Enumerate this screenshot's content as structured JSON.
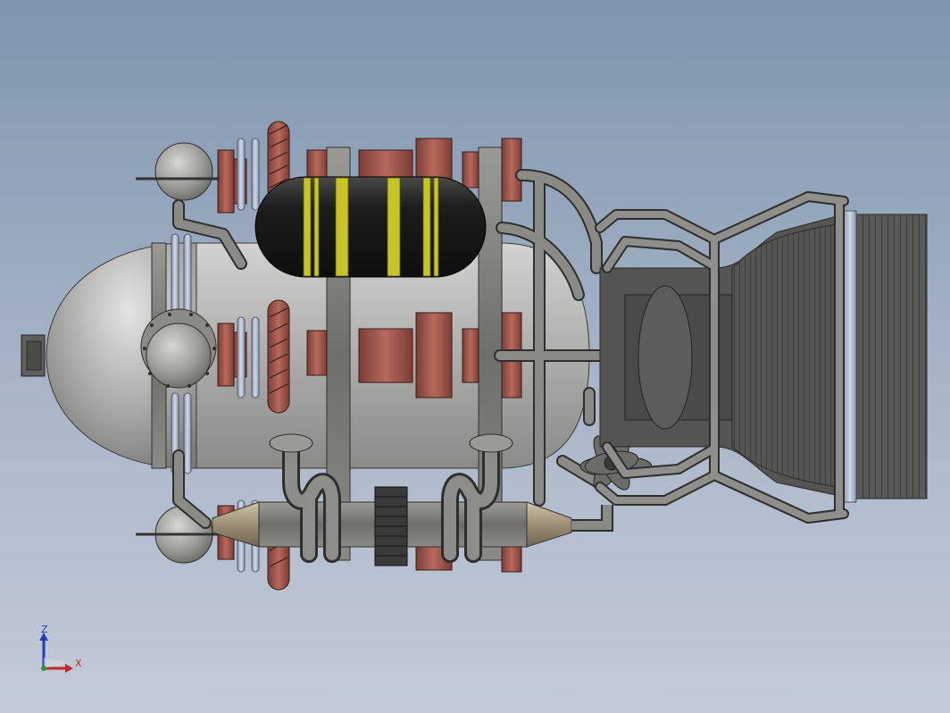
{
  "viewport": {
    "background_top": "#7f95ae",
    "background_bottom": "#c4cad8",
    "model": "rocket-engine-assembly"
  },
  "triad": {
    "z_label": "Z",
    "x_label": "X",
    "z_color": "#1f3fb3",
    "x_color": "#c0272d"
  },
  "colors": {
    "copper": "#a85a4e",
    "steel": "#7a7a74",
    "tank_black": "#1d1d1d",
    "stripe_yellow": "#c8c327",
    "nozzle_dark": "#4e4e4c"
  }
}
